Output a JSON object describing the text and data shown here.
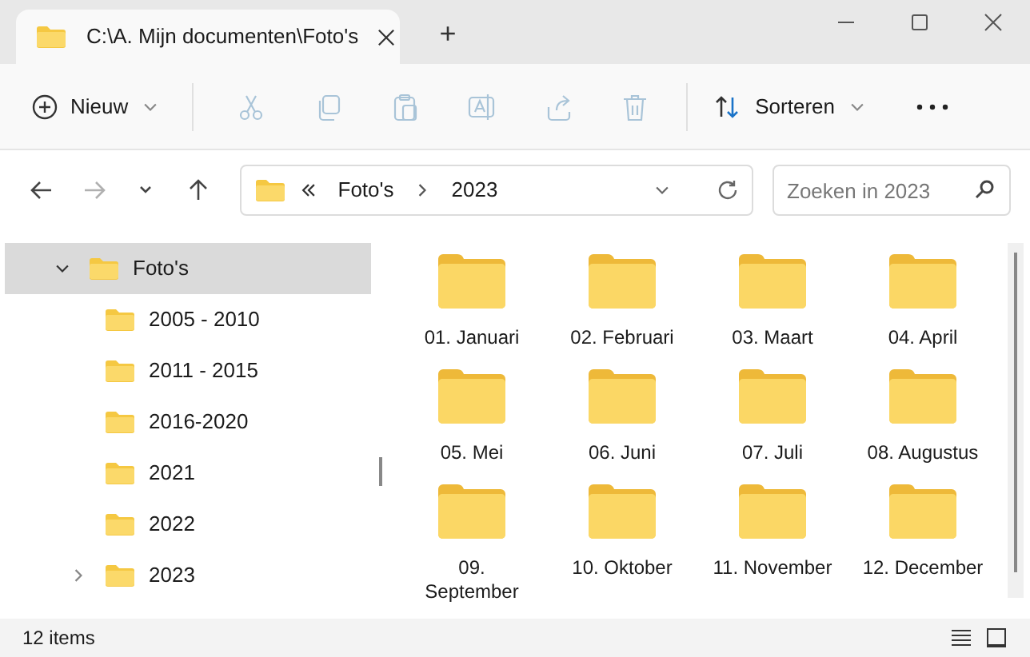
{
  "tabs": [
    {
      "title": "C:\\A. Mijn documenten\\Foto's",
      "selected": true
    }
  ],
  "new_tab": "+",
  "toolbar": {
    "new_button": {
      "label": "Nieuw"
    },
    "actions": [
      {
        "kind": "cut",
        "disabled": true
      },
      {
        "kind": "copy",
        "disabled": true
      },
      {
        "kind": "paste",
        "disabled": true
      },
      {
        "kind": "rename",
        "disabled": true
      },
      {
        "kind": "share",
        "disabled": true
      },
      {
        "kind": "delete",
        "disabled": true
      }
    ],
    "sort_button": {
      "label": "Sorteren"
    }
  },
  "navigation": {
    "back_disabled": false,
    "forward_disabled": true
  },
  "address_bar": {
    "crumbs": [
      "Foto's",
      "2023"
    ]
  },
  "search": {
    "placeholder": "Zoeken in 2023"
  },
  "sidebar": {
    "items": [
      {
        "label": "Foto's",
        "expanded": true,
        "selected": true,
        "children": [
          {
            "label": "2005 - 2010",
            "expandable": false,
            "selected": false
          },
          {
            "label": "2011 - 2015",
            "expandable": false,
            "selected": false
          },
          {
            "label": "2016-2020",
            "expandable": false,
            "selected": false
          },
          {
            "label": "2021",
            "expandable": false,
            "selected": false
          },
          {
            "label": "2022",
            "expandable": false,
            "selected": false
          },
          {
            "label": "2023",
            "expandable": true,
            "selected": false
          }
        ]
      }
    ]
  },
  "folders": [
    {
      "name": "01. Januari"
    },
    {
      "name": "02. Februari"
    },
    {
      "name": "03. Maart"
    },
    {
      "name": "04. April"
    },
    {
      "name": "05. Mei"
    },
    {
      "name": "06. Juni"
    },
    {
      "name": "07. Juli"
    },
    {
      "name": "08. Augustus"
    },
    {
      "name": "09. September"
    },
    {
      "name": "10. Oktober"
    },
    {
      "name": "11. November"
    },
    {
      "name": "12. December"
    }
  ],
  "status_bar": {
    "item_count": "12 items"
  }
}
